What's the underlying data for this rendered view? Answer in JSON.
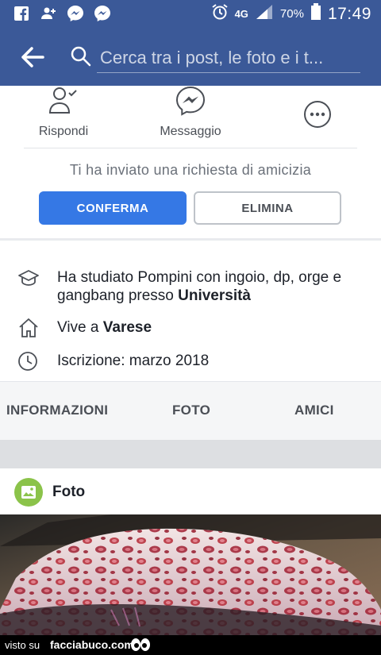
{
  "status_bar": {
    "signal_label": "4G",
    "battery": "70%",
    "time": "17:49"
  },
  "search": {
    "placeholder": "Cerca tra i post, le foto e i t..."
  },
  "actions": {
    "reply_label": "Rispondi",
    "message_label": "Messaggio"
  },
  "friend_request": {
    "text": "Ti ha inviato una richiesta di amicizia",
    "confirm_label": "CONFERMA",
    "delete_label": "ELIMINA"
  },
  "info": {
    "education_prefix": "Ha studiato Pompini con ingoio, dp, orge e gangbang presso",
    "education_place": "Università",
    "lives_prefix": "Vive a",
    "lives_place": "Varese",
    "joined": "Iscrizione: marzo 2018"
  },
  "tabs": [
    "INFORMAZIONI",
    "FOTO",
    "AMICI"
  ],
  "photos_section": {
    "title": "Foto"
  },
  "watermark": {
    "prefix": "visto su",
    "site": "facciabuco.com"
  },
  "colors": {
    "brand": "#3b5998",
    "primary_button": "#3578e5",
    "photos_icon": "#8bc34a"
  }
}
